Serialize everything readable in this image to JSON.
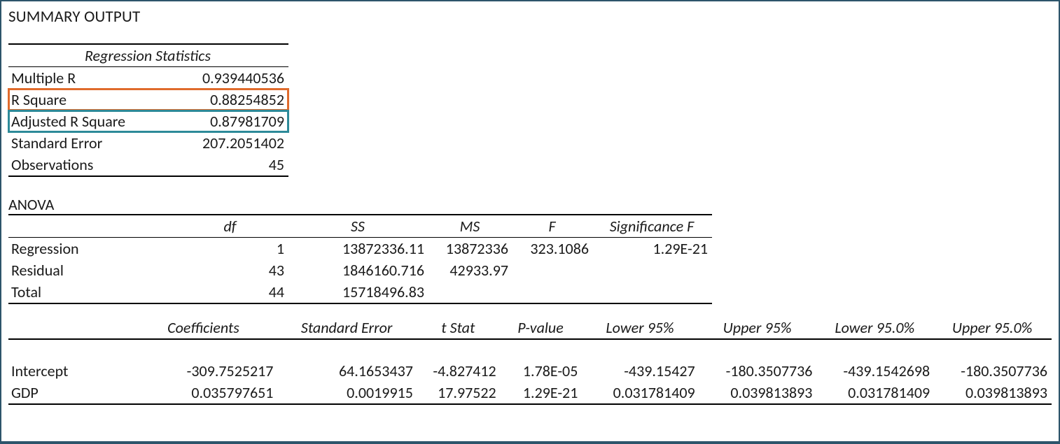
{
  "title": "SUMMARY OUTPUT",
  "regression_statistics": {
    "header": "Regression Statistics",
    "rows": {
      "multiple_r": {
        "label": "Multiple R",
        "value": "0.939440536"
      },
      "r_square": {
        "label": "R Square",
        "value": "0.88254852"
      },
      "adj_r_square": {
        "label": "Adjusted R Square",
        "value": "0.87981709"
      },
      "std_error": {
        "label": "Standard Error",
        "value": "207.2051402"
      },
      "observations": {
        "label": "Observations",
        "value": "45"
      }
    }
  },
  "anova": {
    "title": "ANOVA",
    "headers": {
      "df": "df",
      "ss": "SS",
      "ms": "MS",
      "f": "F",
      "sigf": "Significance F"
    },
    "rows": {
      "regression": {
        "label": "Regression",
        "df": "1",
        "ss": "13872336.11",
        "ms": "13872336",
        "f": "323.1086",
        "sigf": "1.29E-21"
      },
      "residual": {
        "label": "Residual",
        "df": "43",
        "ss": "1846160.716",
        "ms": "42933.97",
        "f": "",
        "sigf": ""
      },
      "total": {
        "label": "Total",
        "df": "44",
        "ss": "15718496.83",
        "ms": "",
        "f": "",
        "sigf": ""
      }
    }
  },
  "coefficients": {
    "headers": {
      "coef": "Coefficients",
      "se": "Standard Error",
      "t": "t Stat",
      "p": "P-value",
      "l95": "Lower 95%",
      "u95": "Upper 95%",
      "l95b": "Lower 95.0%",
      "u95b": "Upper 95.0%"
    },
    "rows": {
      "intercept": {
        "label": "Intercept",
        "coef": "-309.7525217",
        "se": "64.1653437",
        "t": "-4.827412",
        "p": "1.78E-05",
        "l95": "-439.15427",
        "u95": "-180.3507736",
        "l95b": "-439.1542698",
        "u95b": "-180.3507736"
      },
      "gdp": {
        "label": "GDP",
        "coef": "0.035797651",
        "se": "0.0019915",
        "t": "17.97522",
        "p": "1.29E-21",
        "l95": "0.031781409",
        "u95": "0.039813893",
        "l95b": "0.031781409",
        "u95b": "0.039813893"
      }
    }
  }
}
